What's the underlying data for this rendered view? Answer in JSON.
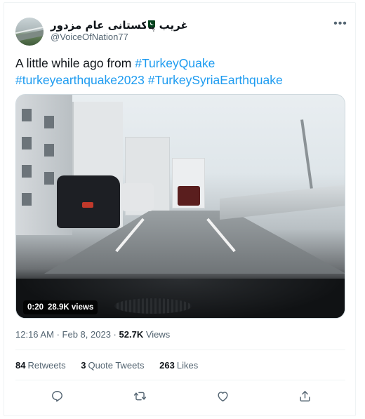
{
  "author": {
    "display_name": "غریب پاکستانی عام مزدور",
    "handle": "@VoiceOfNation77",
    "flag_icon": "pakistan-flag"
  },
  "tweet": {
    "text_plain": "A little while ago from ",
    "hashtags": [
      "#TurkeyQuake",
      "#turkeyearthquake2023",
      "#TurkeySyriaEarthquake"
    ]
  },
  "video": {
    "duration": "0:20",
    "views": "28.9K views"
  },
  "meta": {
    "time": "12:16 AM",
    "separator": "·",
    "date": "Feb 8, 2023",
    "views_count": "52.7K",
    "views_label": "Views"
  },
  "stats": {
    "retweets_count": "84",
    "retweets_label": "Retweets",
    "quotes_count": "3",
    "quotes_label": "Quote Tweets",
    "likes_count": "263",
    "likes_label": "Likes"
  },
  "actions": [
    "reply-icon",
    "retweet-icon",
    "like-icon",
    "share-icon"
  ],
  "colors": {
    "link": "#1d9bf0",
    "secondary_text": "#536471",
    "primary_text": "#0f1419",
    "border": "#eff3f4"
  }
}
